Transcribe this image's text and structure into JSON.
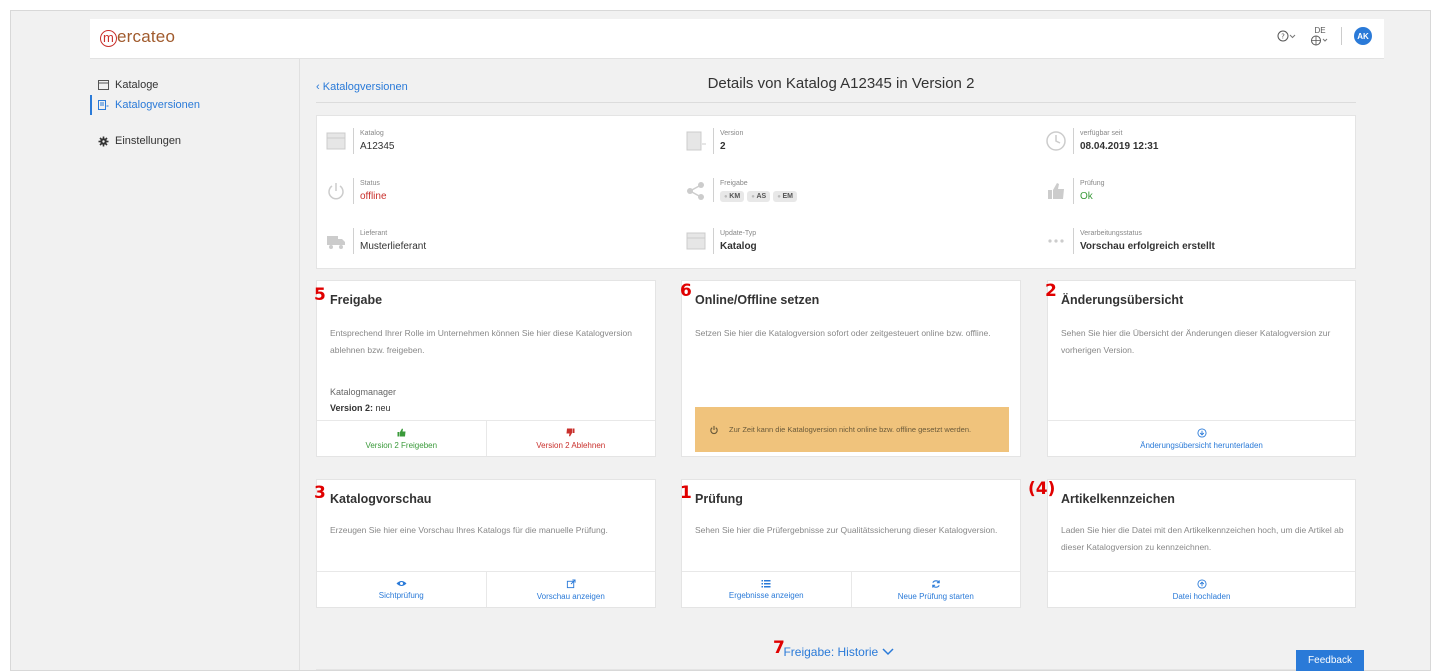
{
  "header": {
    "logo_text": "ercateo",
    "logo_initial": "m",
    "language": "DE",
    "avatar_initials": "AK"
  },
  "sidebar": {
    "items": [
      {
        "label": "Kataloge",
        "icon": "catalog-icon"
      },
      {
        "label": "Katalogversionen",
        "icon": "versions-icon"
      },
      {
        "label": "Einstellungen",
        "icon": "gear-icon"
      }
    ]
  },
  "main": {
    "back_link": "Katalogversionen",
    "title": "Details von Katalog A12345 in Version 2"
  },
  "info": {
    "katalog": {
      "label": "Katalog",
      "value": "A12345"
    },
    "version": {
      "label": "Version",
      "value": "2"
    },
    "verfuegbar": {
      "label": "verfügbar seit",
      "value": "08.04.2019 12:31"
    },
    "status": {
      "label": "Status",
      "value": "offline"
    },
    "freigabe": {
      "label": "Freigabe",
      "chips": [
        "KM",
        "AS",
        "EM"
      ]
    },
    "pruefung": {
      "label": "Prüfung",
      "value": "Ok"
    },
    "lieferant": {
      "label": "Lieferant",
      "value": "Musterlieferant"
    },
    "update_typ": {
      "label": "Update-Typ",
      "value": "Katalog"
    },
    "verarbeitung": {
      "label": "Verarbeitungsstatus",
      "value": "Vorschau erfolgreich erstellt"
    }
  },
  "cards": {
    "freigabe": {
      "marker": "5",
      "title": "Freigabe",
      "text": "Entsprechend Ihrer Rolle im Unternehmen können Sie hier diese Katalogversion ablehnen bzw. freigeben.",
      "role_label": "Katalogmanager",
      "role_value_bold": "Version 2:",
      "role_value": " neu",
      "action_approve": "Version 2 Freigeben",
      "action_reject": "Version 2 Ablehnen"
    },
    "online": {
      "marker": "6",
      "title": "Online/Offline setzen",
      "text": "Setzen Sie hier die Katalogversion sofort oder zeitgesteuert online bzw. offline.",
      "warning": "Zur Zeit kann die Katalogversion nicht online bzw. offline gesetzt werden."
    },
    "aenderung": {
      "marker": "2",
      "title": "Änderungsübersicht",
      "text": "Sehen Sie hier die Übersicht der Änderungen dieser Katalogversion zur vorherigen Version.",
      "action": "Änderungsübersicht herunterladen"
    },
    "vorschau": {
      "marker": "3",
      "title": "Katalogvorschau",
      "text": "Erzeugen Sie hier eine Vorschau Ihres Katalogs für die manuelle Prüfung.",
      "action_view": "Sichtprüfung",
      "action_show": "Vorschau anzeigen"
    },
    "pruefung": {
      "marker": "1",
      "title": "Prüfung",
      "text": "Sehen Sie hier die Prüfergebnisse zur Qualitätssicherung dieser Katalogversion.",
      "action_results": "Ergebnisse anzeigen",
      "action_new": "Neue Prüfung starten"
    },
    "artikel": {
      "marker": "(4)",
      "title": "Artikelkennzeichen",
      "text": "Laden Sie hier die Datei mit den Artikelkennzeichen hoch, um die Artikel ab dieser Katalogversion zu kennzeichnen.",
      "action": "Datei hochladen"
    }
  },
  "history": {
    "marker": "7",
    "label": "Freigabe: Historie"
  },
  "feedback_label": "Feedback",
  "colors": {
    "accent": "#2a7ad8",
    "danger": "#c9302c",
    "success": "#3a9a3a",
    "warning_bg": "#f0c37c"
  }
}
